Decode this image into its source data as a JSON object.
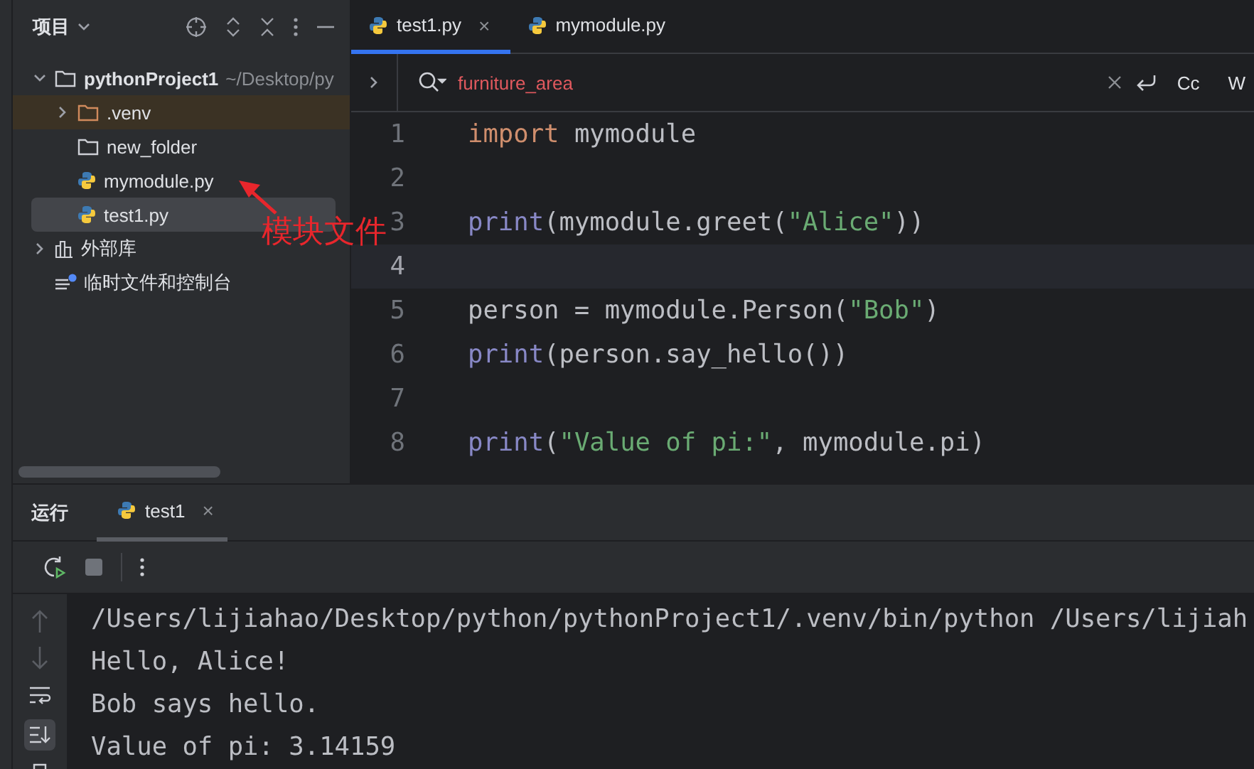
{
  "project_panel": {
    "title": "项目",
    "tree": [
      {
        "label": "pythonProject1",
        "path": "~/Desktop/py",
        "kind": "project",
        "expanded": true,
        "selected": false,
        "children": [
          {
            "label": ".venv",
            "kind": "excluded-folder",
            "expanded": false,
            "selected": false
          },
          {
            "label": "new_folder",
            "kind": "folder",
            "selected": false
          },
          {
            "label": "mymodule.py",
            "kind": "python",
            "selected": false
          },
          {
            "label": "test1.py",
            "kind": "python",
            "selected": true
          }
        ]
      },
      {
        "label": "外部库",
        "kind": "library",
        "expanded": false,
        "selected": false
      },
      {
        "label": "临时文件和控制台",
        "kind": "scratches",
        "selected": false
      }
    ]
  },
  "annotation": {
    "text": "模块文件"
  },
  "editor": {
    "tabs": [
      {
        "label": "test1.py",
        "selected": true,
        "close": "×"
      },
      {
        "label": "mymodule.py",
        "selected": false
      }
    ],
    "find_bar": {
      "query": "furniture_area",
      "no_matches": true,
      "options": [
        "Cc",
        "W"
      ]
    },
    "lines": [
      {
        "number": "1",
        "current": false,
        "tokens": [
          {
            "kind": "keyword",
            "text": "import"
          },
          {
            "kind": "plain",
            "text": " mymodule"
          }
        ]
      },
      {
        "number": "2",
        "current": false
      },
      {
        "number": "3",
        "current": false,
        "tokens": [
          {
            "kind": "builtin",
            "text": "print"
          },
          {
            "kind": "plain",
            "text": "(mymodule.greet("
          },
          {
            "kind": "string",
            "text": "\"Alice\""
          },
          {
            "kind": "plain",
            "text": "))"
          }
        ]
      },
      {
        "number": "4",
        "current": true
      },
      {
        "number": "5",
        "current": false,
        "tokens": [
          {
            "kind": "plain",
            "text": "person = mymodule.Person("
          },
          {
            "kind": "string",
            "text": "\"Bob\""
          },
          {
            "kind": "plain",
            "text": ")"
          }
        ]
      },
      {
        "number": "6",
        "current": false,
        "tokens": [
          {
            "kind": "builtin",
            "text": "print"
          },
          {
            "kind": "plain",
            "text": "(person.say_hello())"
          }
        ]
      },
      {
        "number": "7",
        "current": false
      },
      {
        "number": "8",
        "current": false,
        "tokens": [
          {
            "kind": "builtin",
            "text": "print"
          },
          {
            "kind": "plain",
            "text": "("
          },
          {
            "kind": "string",
            "text": "\"Value of pi:\""
          },
          {
            "kind": "plain",
            "text": ", mymodule.pi)"
          }
        ]
      }
    ]
  },
  "run_panel": {
    "title": "运行",
    "tabs": [
      {
        "label": "test1",
        "selected": true,
        "close": "×"
      }
    ],
    "scroll_to_end": true,
    "console": [
      "/Users/lijiahao/Desktop/python/pythonProject1/.venv/bin/python /Users/lijiah",
      "Hello, Alice!",
      "Bob says hello.",
      "Value of pi: 3.14159"
    ]
  }
}
